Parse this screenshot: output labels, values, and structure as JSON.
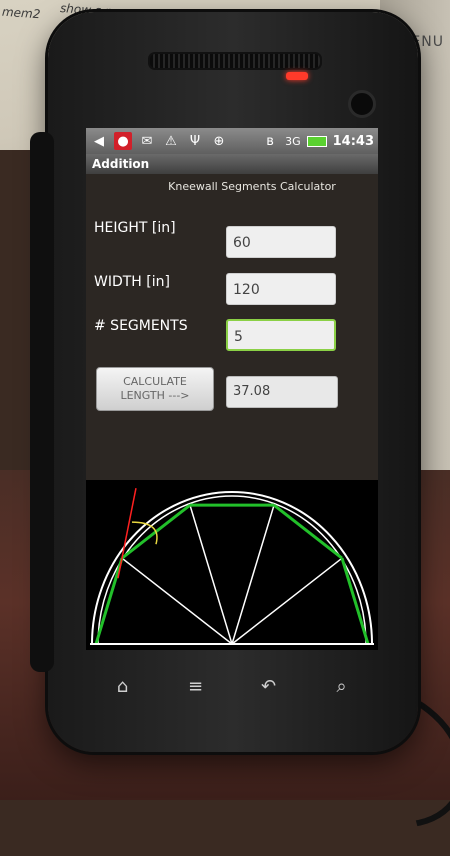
{
  "scene": {
    "paper_scribble_1": "show s mem z",
    "paper_scribble_2": "mem2",
    "menu_label": "MENU"
  },
  "status_bar": {
    "network": "3G",
    "time": "14:43"
  },
  "app": {
    "title": "Addition",
    "subtitle": "Kneewall Segments Calculator"
  },
  "form": {
    "height_label": "HEIGHT [in]",
    "height_value": "60",
    "width_label": "WIDTH [in]",
    "width_value": "120",
    "segments_label": "# SEGMENTS",
    "segments_value": "5",
    "calc_label_1": "CALCULATE",
    "calc_label_2": "LENGTH --->",
    "result_value": "37.08"
  },
  "drawing": {
    "segments": 5,
    "colors": {
      "arc": "#ffffff",
      "segments": "#22c02a",
      "radials": "#ffffff",
      "tangent": "#ff2020",
      "angle": "#e8d840"
    }
  },
  "nav": {
    "home": "⌂",
    "menu": "≡",
    "back": "↶",
    "search": "⌕"
  }
}
